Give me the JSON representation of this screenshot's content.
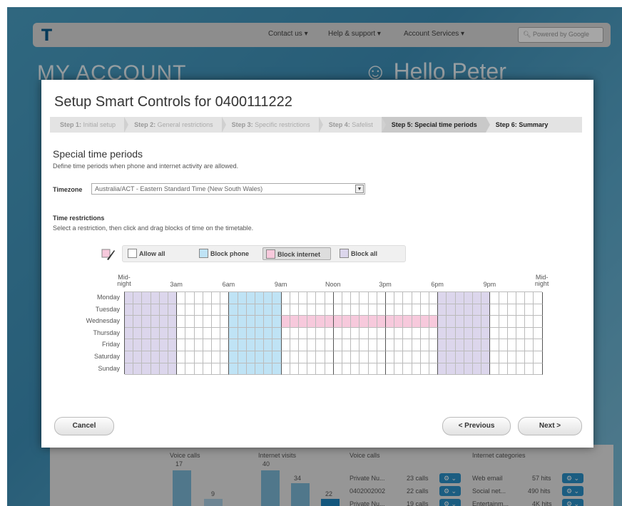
{
  "background": {
    "nav": [
      "Contact us ▾",
      "Help & support ▾",
      "Account Services ▾"
    ],
    "search_placeholder": "Powered by Google",
    "title": "MY ACCOUNT",
    "greeting": "Hello Peter",
    "bottom": {
      "voice_calls_label": "Voice calls",
      "internet_visits_label": "Internet visits",
      "voice_calls_label_2": "Voice calls",
      "internet_categories_label": "Internet categories",
      "bar_values": [
        "17",
        "9",
        "40",
        "34",
        "22"
      ],
      "rows": [
        {
          "name": "Private Nu...",
          "count": "23 calls",
          "cat": "Web email",
          "hits": "57 hits"
        },
        {
          "name": "0402002002",
          "count": "22 calls",
          "cat": "Social net...",
          "hits": "490 hits"
        },
        {
          "name": "Private Nu...",
          "count": "19 calls",
          "cat": "Entertainm...",
          "hits": "4K hits"
        }
      ]
    }
  },
  "modal": {
    "title": "Setup Smart Controls for 0400111222",
    "steps": [
      {
        "num": "Step 1:",
        "label": "Initial setup"
      },
      {
        "num": "Step 2:",
        "label": "General restrictions"
      },
      {
        "num": "Step 3:",
        "label": "Specific restrictions"
      },
      {
        "num": "Step 4:",
        "label": "Safelist"
      },
      {
        "num": "Step 5:",
        "label": "Special time periods"
      },
      {
        "num": "Step 6:",
        "label": "Summary"
      }
    ],
    "section_title": "Special time periods",
    "section_desc": "Define time periods when phone and internet activity are allowed.",
    "timezone_label": "Timezone",
    "timezone_value": "Australia/ACT - Eastern Standard Time (New South Wales)",
    "restrictions_title": "Time restrictions",
    "restrictions_desc": "Select a restriction, then click and drag blocks of time on the timetable.",
    "legend": [
      {
        "label": "Allow all",
        "color": "#ffffff"
      },
      {
        "label": "Block phone",
        "color": "#bfe3f5"
      },
      {
        "label": "Block internet",
        "color": "#f7c9dc"
      },
      {
        "label": "Block all",
        "color": "#dcd6ec"
      }
    ],
    "hour_labels": [
      "Mid-\nnight",
      "3am",
      "6am",
      "9am",
      "Noon",
      "3pm",
      "6pm",
      "9pm",
      "Mid-\nnight"
    ],
    "days": [
      "Monday",
      "Tuesday",
      "Wednesday",
      "Thursday",
      "Friday",
      "Saturday",
      "Sunday"
    ],
    "schedule": {
      "block_all": [
        {
          "days": [
            0,
            1,
            2,
            3,
            4,
            5,
            6
          ],
          "from": 0,
          "to": 6
        },
        {
          "days": [
            0,
            1,
            2,
            3,
            4,
            5,
            6
          ],
          "from": 36,
          "to": 42
        }
      ],
      "block_phone": [
        {
          "days": [
            0,
            1,
            2,
            3,
            4,
            5,
            6
          ],
          "from": 12,
          "to": 18
        }
      ],
      "block_internet": [
        {
          "days": [
            2
          ],
          "from": 18,
          "to": 36
        }
      ]
    },
    "cancel_label": "Cancel",
    "previous_label": "< Previous",
    "next_label": "Next >"
  }
}
